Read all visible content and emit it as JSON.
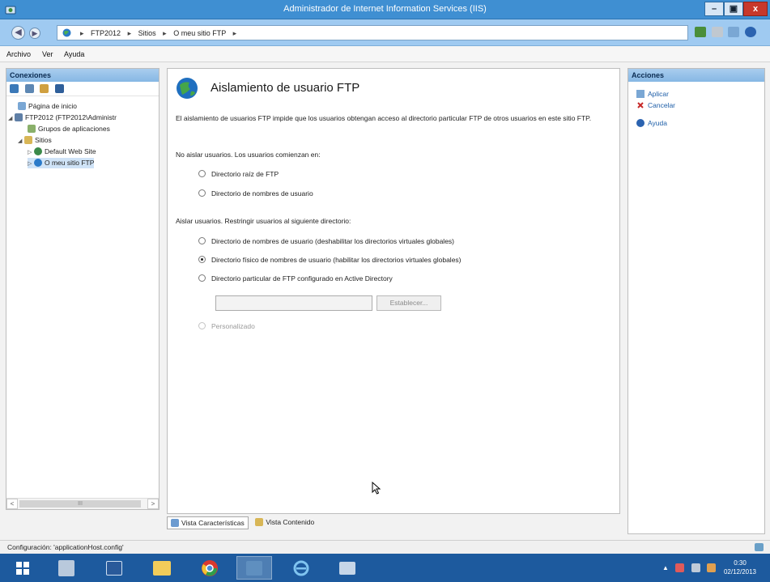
{
  "window": {
    "title": "Administrador de Internet Information Services (IIS)",
    "controls": {
      "minimize": "–",
      "maximize": "▣",
      "close": "x"
    }
  },
  "address": {
    "breadcrumbs": [
      "FTP2012",
      "Sitios",
      "O meu sitio FTP"
    ],
    "separator": "▸"
  },
  "menu": {
    "items": [
      "Archivo",
      "Ver",
      "Ayuda"
    ]
  },
  "connections": {
    "title": "Conexiones",
    "tree": {
      "home": "Página de inicio",
      "server": "FTP2012 (FTP2012\\Administr",
      "app_pools": "Grupos de aplicaciones",
      "sites": "Sitios",
      "default_site": "Default Web Site",
      "ftp_site": "O meu sitio FTP"
    },
    "scroll_left": "<",
    "scroll_right": ">",
    "scroll_grip": "III"
  },
  "main": {
    "title": "Aislamiento de usuario FTP",
    "description": "El aislamiento de usuarios FTP impide que los usuarios obtengan acceso al directorio particular FTP de otros usuarios en este sitio FTP.",
    "no_isolate_heading": "No aislar usuarios. Los usuarios comienzan en:",
    "option_root": "Directorio raíz de FTP",
    "option_username_dir": "Directorio de nombres de usuario",
    "isolate_heading": "Aislar usuarios. Restringir usuarios al siguiente directorio:",
    "option_username_disable_global": "Directorio de nombres de usuario (deshabilitar los directorios virtuales globales)",
    "option_physical_enable_global": "Directorio físico de nombres de usuario (habilitar los directorios virtuales globales)",
    "option_active_directory": "Directorio particular de FTP configurado en Active Directory",
    "ad_path_value": "",
    "set_button": "Establecer...",
    "option_custom": "Personalizado",
    "selected_option": "option_physical_enable_global"
  },
  "view_tabs": {
    "features": "Vista Características",
    "content": "Vista Contenido"
  },
  "actions": {
    "title": "Acciones",
    "apply": "Aplicar",
    "cancel": "Cancelar",
    "help": "Ayuda"
  },
  "status": {
    "text": "Configuración: 'applicationHost.config'"
  },
  "taskbar": {
    "clock_time": "0:30",
    "clock_date": "02/12/2013",
    "tray_arrow": "▲"
  },
  "colors": {
    "title_bar": "#3f8fd2",
    "address_bar": "#9fcaf1",
    "panel_header": "#86b7e4",
    "link": "#1f5fa8",
    "taskbar": "#1d5a9e"
  }
}
